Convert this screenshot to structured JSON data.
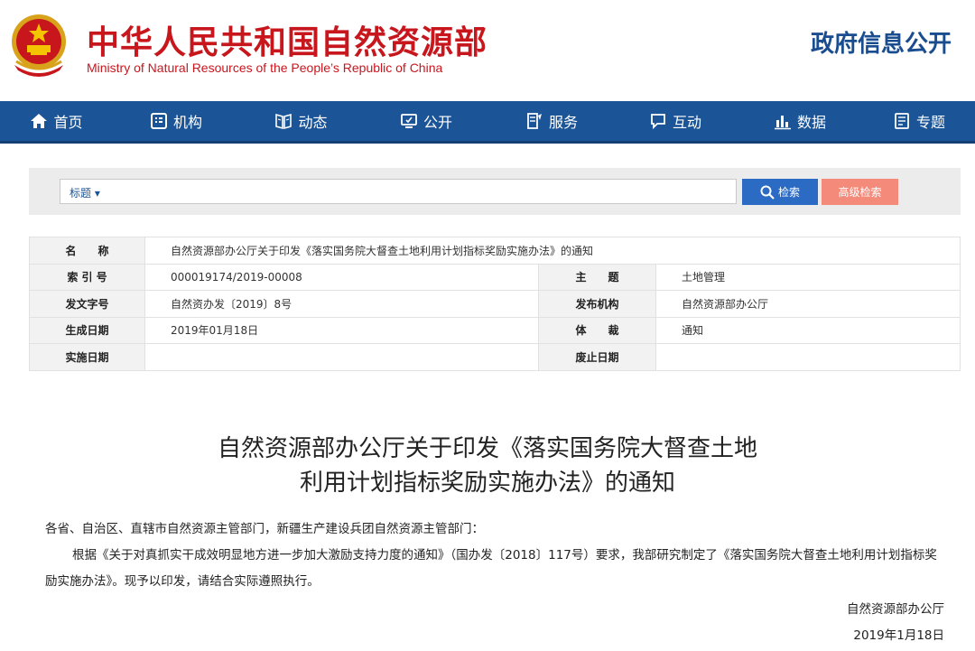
{
  "header": {
    "ministry_name_cn": "中华人民共和国自然资源部",
    "ministry_name_en": "Ministry of Natural Resources of the People’s Republic of China",
    "gov_info": "政府信息公开",
    "emblem_icon": "national-emblem-icon"
  },
  "nav": {
    "items": [
      {
        "label": "首页",
        "icon": "home-icon"
      },
      {
        "label": "机构",
        "icon": "org-icon"
      },
      {
        "label": "动态",
        "icon": "news-icon"
      },
      {
        "label": "公开",
        "icon": "disclosure-icon"
      },
      {
        "label": "服务",
        "icon": "service-icon"
      },
      {
        "label": "互动",
        "icon": "chat-icon"
      },
      {
        "label": "数据",
        "icon": "bar-chart-icon"
      },
      {
        "label": "专题",
        "icon": "topic-icon"
      }
    ]
  },
  "search": {
    "field_label": "标题 ▾",
    "query": "",
    "search_button": "检索",
    "advanced_button": "高级检索"
  },
  "meta": {
    "name_label": "名　　称",
    "name_value": "自然资源部办公厅关于印发《落实国务院大督查土地利用计划指标奖励实施办法》的通知",
    "index_label": "索 引 号",
    "index_value": "000019174/2019-00008",
    "topic_label": "主　　题",
    "topic_value": "土地管理",
    "doc_no_label": "发文字号",
    "doc_no_value": "自然资办发〔2019〕8号",
    "issuer_label": "发布机构",
    "issuer_value": "自然资源部办公厅",
    "created_label": "生成日期",
    "created_value": "2019年01月18日",
    "genre_label": "体　　裁",
    "genre_value": "通知",
    "effective_label": "实施日期",
    "effective_value": "",
    "expiry_label": "废止日期",
    "expiry_value": ""
  },
  "article": {
    "title_line1": "自然资源部办公厅关于印发《落实国务院大督查土地",
    "title_line2": "利用计划指标奖励实施办法》的通知",
    "salutation": "各省、自治区、直辖市自然资源主管部门，新疆生产建设兵团自然资源主管部门：",
    "paragraph1": "根据《关于对真抓实干成效明显地方进一步加大激励支持力度的通知》（国办发〔2018〕117号）要求，我部研究制定了《落实国务院大督查土地利用计划指标奖励实施办法》。现予以印发，请结合实际遵照执行。",
    "signature": "自然资源部办公厅",
    "date": "2019年1月18日"
  },
  "colors": {
    "brand_red": "#c8161d",
    "nav_blue": "#1c5597",
    "search_blue": "#2b6bc4",
    "advanced_pink": "#f48a7a"
  }
}
